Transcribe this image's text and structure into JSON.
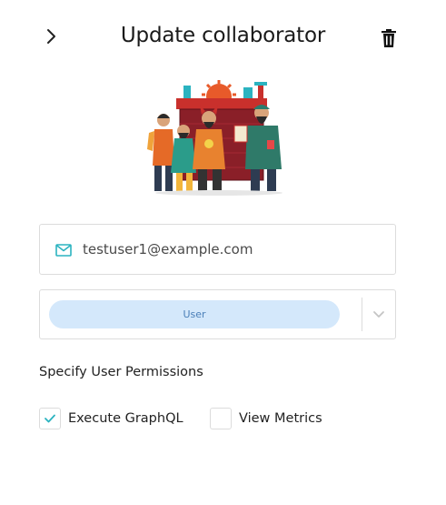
{
  "header": {
    "title": "Update collaborator",
    "back_icon": "chevron-right-icon",
    "delete_icon": "trash-icon"
  },
  "illustration": {
    "icon": "team-collaboration-illustration"
  },
  "email_field": {
    "icon": "mail-icon",
    "value": "testuser1@example.com"
  },
  "role_select": {
    "selected": "User",
    "dropdown_icon": "chevron-down-icon"
  },
  "permissions": {
    "heading": "Specify User Permissions",
    "items": [
      {
        "label": "Execute GraphQL",
        "checked": true
      },
      {
        "label": "View Metrics",
        "checked": false
      }
    ]
  },
  "colors": {
    "accent": "#2bb3c0",
    "chip_bg": "#d4e8fb",
    "chip_text": "#4a7fb8",
    "border": "#dcdcdc"
  }
}
